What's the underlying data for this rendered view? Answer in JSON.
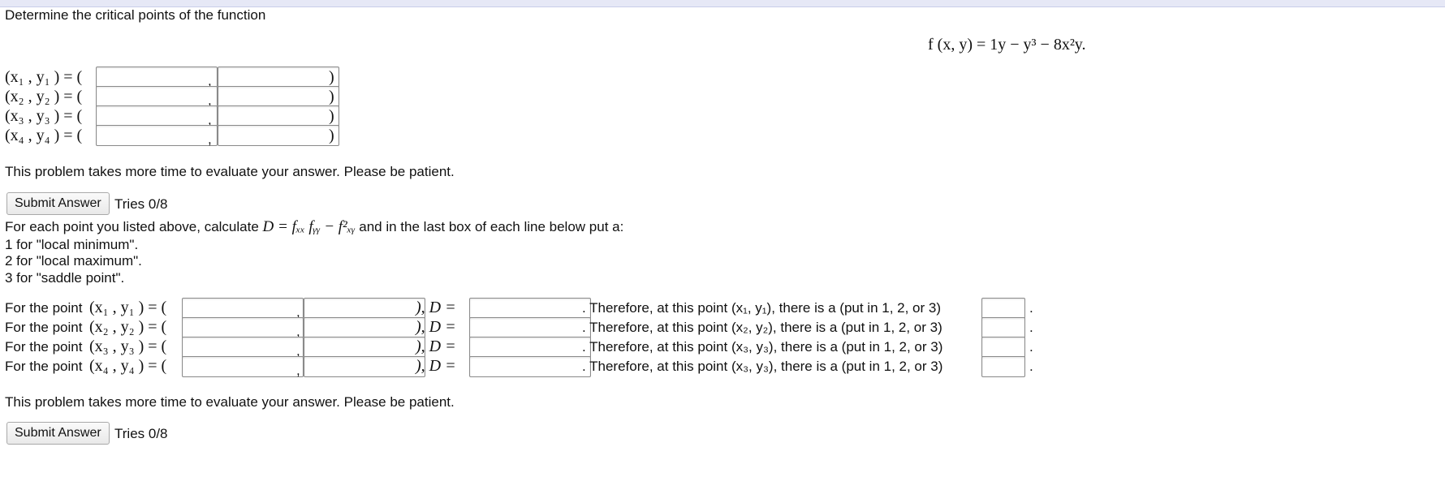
{
  "prompt": "Determine the critical points of the function",
  "function_eq": "f (x, y) = 1y − y³ − 8x²y.",
  "points": [
    {
      "label": "(x₁ , y₁ ) = (",
      "close": ")",
      "comma": ","
    },
    {
      "label": "(x₂ , y₂ ) = (",
      "close": ")",
      "comma": ","
    },
    {
      "label": "(x₃ , y₃ ) = (",
      "close": ")",
      "comma": ","
    },
    {
      "label": "(x₄ , y₄ ) = (",
      "close": ")",
      "comma": ","
    }
  ],
  "notice": "This problem takes more time to evaluate your answer. Please be patient.",
  "submit": {
    "label": "Submit Answer",
    "tries": "Tries 0/8"
  },
  "instructions": {
    "lead": "For each point you listed above, calculate",
    "formula": "D = fₓₓ fᵧᵧ − f²ₓᵧ",
    "tail": "and in the last box of each line below put a:",
    "options": [
      "1 for \"local minimum\".",
      "2 for \"local maximum\".",
      "3 for \"saddle point\"."
    ]
  },
  "classify_rows": [
    {
      "prefix": "For the point",
      "pt": "(x₁ , y₁ ) = (",
      "mid": "),  D =",
      "therefore": ". Therefore, at this point (x₁, y₁), there is a (put in 1, 2, or 3)",
      "end": "."
    },
    {
      "prefix": "For the point",
      "pt": "(x₂ , y₂ ) = (",
      "mid": "),  D =",
      "therefore": ". Therefore, at this point (x₂, y₂), there is a (put in 1, 2, or 3)",
      "end": "."
    },
    {
      "prefix": "For the point",
      "pt": "(x₃ , y₃ ) = (",
      "mid": "),  D =",
      "therefore": ". Therefore, at this point (x₃, y₃), there is a (put in 1, 2, or 3)",
      "end": "."
    },
    {
      "prefix": "For the point",
      "pt": "(x₄ , y₄ ) = (",
      "mid": "),  D =",
      "therefore": ". Therefore, at this point (x₃, y₃), there is a (put in 1, 2, or 3)",
      "end": "."
    }
  ],
  "notice2": "This problem takes more time to evaluate your answer. Please be patient.",
  "submit2": {
    "label": "Submit Answer",
    "tries": "Tries 0/8"
  }
}
